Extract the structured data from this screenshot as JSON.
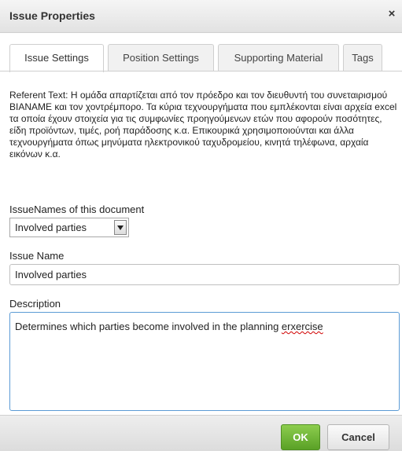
{
  "dialog": {
    "title": "Issue Properties",
    "close_glyph": "×"
  },
  "tabs": [
    {
      "label": "Issue Settings",
      "active": true
    },
    {
      "label": "Position Settings",
      "active": false
    },
    {
      "label": "Supporting Material",
      "active": false
    },
    {
      "label": "Tags",
      "active": false
    }
  ],
  "referent_text": "Referent Text: Η ομάδα απαρτίζεται από τον πρόεδρο και τον διευθυντή του συνεταιρισμού ΒΙΑΝΑΜΕ και τον χοντρέμπορο. Τα κύρια τεχνουργήματα που εμπλέκονται είναι αρχεία excel τα οποία έχουν στοιχεία για τις συμφωνίες προηγούμενων ετών που αφορούν ποσότητες, είδη προϊόντων, τιμές, ροή παράδοσης κ.α. Επικουρικά χρησιμοποιούνται και άλλα τεχνουργήματα όπως μηνύματα ηλεκτρονικού ταχυδρομείου, κινητά τηλέφωνα, αρχαία εικόνων κ.α.",
  "issue_names": {
    "label": "IssueNames of this document",
    "selected": "Involved parties"
  },
  "issue_name": {
    "label": "Issue Name",
    "value": "Involved parties"
  },
  "description": {
    "label": "Description",
    "value_main": "Determines which parties become involved in the planning ",
    "value_misspelled": "erxercise"
  },
  "buttons": {
    "ok": "OK",
    "cancel": "Cancel"
  },
  "colors": {
    "ok_green": "#6ab52f",
    "focus_blue": "#5b9bd5"
  }
}
